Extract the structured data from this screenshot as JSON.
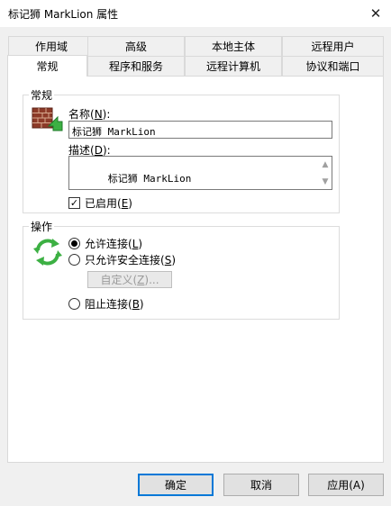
{
  "window": {
    "title": "标记狮 MarkLion 属性",
    "close_symbol": "✕"
  },
  "tabs": {
    "row_back": [
      "作用域",
      "高级",
      "本地主体",
      "远程用户"
    ],
    "row_front": [
      "常规",
      "程序和服务",
      "远程计算机",
      "协议和端口"
    ],
    "active": "常规"
  },
  "general": {
    "legend": "常规",
    "icon": "firewall-rule-icon",
    "name_label_pre": "名称(",
    "name_label_key": "N",
    "name_label_post": "):",
    "name_value": "标记狮 MarkLion",
    "desc_label_pre": "描述(",
    "desc_label_key": "D",
    "desc_label_post": "):",
    "desc_value": "标记狮 MarkLion",
    "enabled_pre": "已启用(",
    "enabled_key": "E",
    "enabled_post": ")",
    "enabled_checked": "✓"
  },
  "action": {
    "legend": "操作",
    "icon": "recycle-arrows-icon",
    "allow_pre": "允许连接(",
    "allow_key": "L",
    "allow_post": ")",
    "secure_pre": "只允许安全连接(",
    "secure_key": "S",
    "secure_post": ")",
    "custom_pre": "自定义(",
    "custom_key": "Z",
    "custom_post": ")...",
    "block_pre": "阻止连接(",
    "block_key": "B",
    "block_post": ")",
    "selected": "allow"
  },
  "buttons": {
    "ok": "确定",
    "cancel": "取消",
    "apply": "应用(A)"
  },
  "colors": {
    "accent": "#0078d7",
    "arrow_green": "#3cb043",
    "brick": "#a0412d"
  }
}
